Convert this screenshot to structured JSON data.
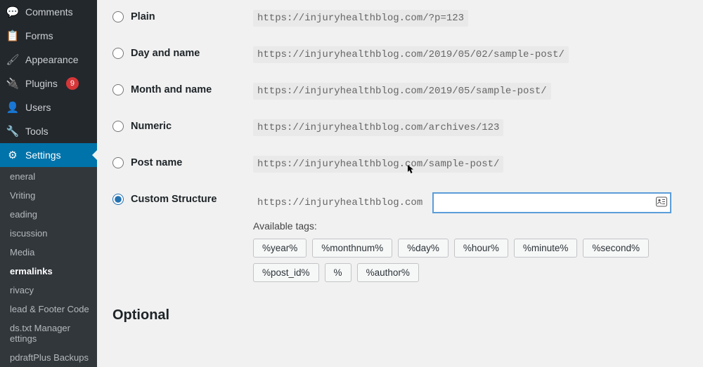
{
  "sidebar": {
    "items": [
      {
        "label": "Comments",
        "icon": "💬"
      },
      {
        "label": "Forms",
        "icon": "📋"
      }
    ],
    "items2": [
      {
        "label": "Appearance",
        "icon": "🖌"
      },
      {
        "label": "Plugins",
        "icon": "🔌",
        "badge": "9"
      },
      {
        "label": "Users",
        "icon": "👤"
      },
      {
        "label": "Tools",
        "icon": "🔧"
      },
      {
        "label": "Settings",
        "icon": "⚙",
        "active": true
      }
    ],
    "sub": [
      "eneral",
      "Vriting",
      "eading",
      "iscussion",
      "Media",
      "ermalinks",
      "rivacy",
      "lead & Footer Code",
      "ds.txt Manager ettings",
      "pdraftPlus Backups"
    ]
  },
  "base_url": "https://injuryhealthblog.com",
  "options": [
    {
      "name": "Plain",
      "sample": "https://injuryhealthblog.com/?p=123"
    },
    {
      "name": "Day and name",
      "sample": "https://injuryhealthblog.com/2019/05/02/sample-post/"
    },
    {
      "name": "Month and name",
      "sample": "https://injuryhealthblog.com/2019/05/sample-post/"
    },
    {
      "name": "Numeric",
      "sample": "https://injuryhealthblog.com/archives/123"
    },
    {
      "name": "Post name",
      "sample": "https://injuryhealthblog.com/sample-post/"
    }
  ],
  "custom": {
    "label": "Custom Structure",
    "value": "",
    "avail_label": "Available tags:",
    "tags": [
      "%year%",
      "%monthnum%",
      "%day%",
      "%hour%",
      "%minute%",
      "%second%",
      "%post_id%",
      "%",
      "%author%"
    ]
  },
  "optional_heading": "Optional"
}
